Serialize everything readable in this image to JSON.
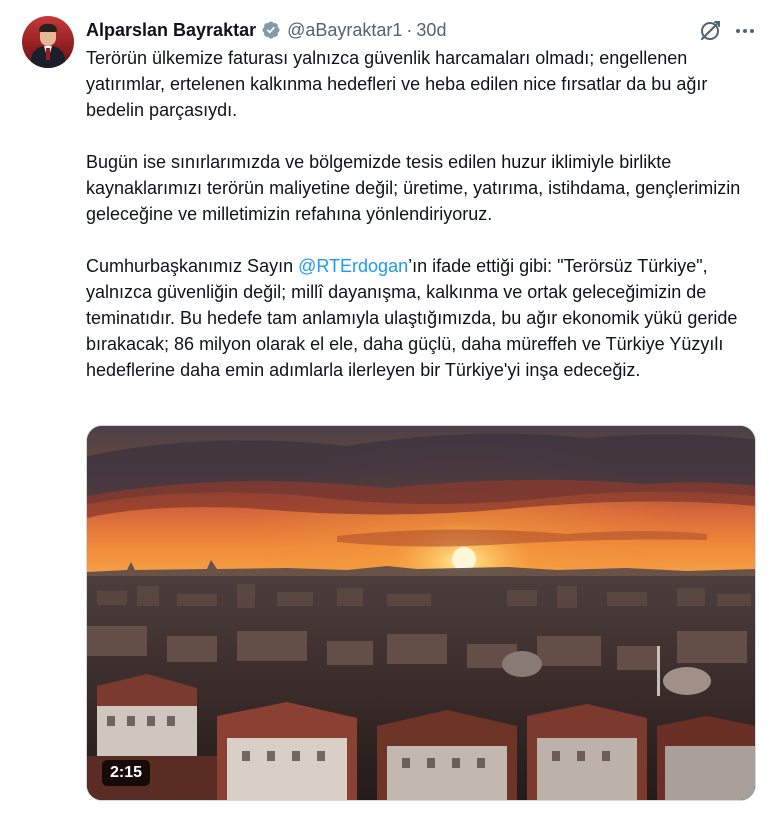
{
  "author": {
    "name": "Alparslan Bayraktar",
    "handle": "@aBayraktar1",
    "separator": "·",
    "time": "30d"
  },
  "icons": {
    "verified": "verified-badge-icon",
    "grok": "grok-icon",
    "more": "more-icon"
  },
  "colors": {
    "verified": "#829aab",
    "link": "#1d9bf0",
    "muted": "#536471"
  },
  "tweet": {
    "paragraph1": "Terörün ülkemize faturası yalnızca güvenlik harcamaları olmadı; engellenen yatırımlar, ertelenen kalkınma hedefleri ve heba edilen nice fırsatlar da bu ağır bedelin parçasıydı.",
    "paragraph2": "Bugün ise sınırlarımızda ve bölgemizde tesis edilen huzur iklimiyle birlikte kaynaklarımızı terörün maliyetine değil; üretime, yatırıma, istihdama, gençlerimizin geleceğine ve milletimizin refahına yönlendiriyoruz.",
    "paragraph3_before": "Cumhurbaşkanımız Sayın ",
    "paragraph3_mention": "@RTErdogan",
    "paragraph3_after": "’ın ifade ettiği gibi: \"Terörsüz Türkiye\", yalnızca güvenliğin değil; millî dayanışma, kalkınma ve ortak geleceğimizin de teminatıdır. Bu hedefe tam anlamıyla ulaştığımızda, bu ağır ekonomik yükü geride bırakacak; 86 milyon olarak el ele, daha güçlü, daha müreffeh ve Türkiye Yüzyılı hedeflerine daha emin adımlarla ilerleyen bir Türkiye'yi inşa edeceğiz."
  },
  "media": {
    "duration": "2:15"
  }
}
